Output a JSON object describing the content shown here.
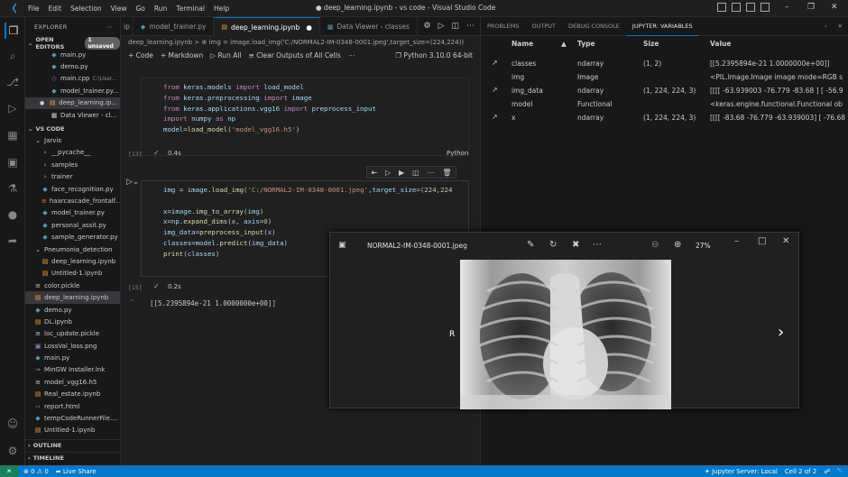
{
  "titlebar": {
    "menu": [
      "File",
      "Edit",
      "Selection",
      "View",
      "Go",
      "Run",
      "Terminal",
      "Help"
    ],
    "window_title": "● deep_learning.ipynb - vs code - Visual Studio Code"
  },
  "sidebar": {
    "header": "EXPLORER",
    "open_editors_label": "OPEN EDITORS",
    "unsaved_badge": "1 unsaved",
    "open_editors": [
      {
        "name": "main.py",
        "icon": "python-icon"
      },
      {
        "name": "demo.py",
        "icon": "python-icon"
      },
      {
        "name": "main.cpp",
        "path": "C:\\User...",
        "icon": "cpp-icon"
      },
      {
        "name": "model_trainer.py...",
        "icon": "python-icon"
      },
      {
        "name": "deep_learning.ip...",
        "icon": "notebook-icon"
      },
      {
        "name": "Data Viewer - cl...",
        "icon": "data-icon"
      }
    ],
    "vscode_label": "VS CODE",
    "files": [
      {
        "name": "Jarvis",
        "type": "folder-open"
      },
      {
        "name": "__pycache__",
        "type": "folder"
      },
      {
        "name": "samples",
        "type": "folder"
      },
      {
        "name": "trainer",
        "type": "folder"
      },
      {
        "name": "face_recognition.py",
        "type": "python"
      },
      {
        "name": "haarcascade_frontalf...",
        "type": "xml"
      },
      {
        "name": "model_trainer.py",
        "type": "python"
      },
      {
        "name": "personal_assit.py",
        "type": "python"
      },
      {
        "name": "sample_generator.py",
        "type": "python"
      },
      {
        "name": "Pneumonia_detection",
        "type": "folder-open"
      },
      {
        "name": "deep_learning.ipynb",
        "type": "notebook"
      },
      {
        "name": "Untitled-1.ipynb",
        "type": "notebook"
      },
      {
        "name": "color.pickle",
        "type": "pickle"
      },
      {
        "name": "deep_learning.ipynb",
        "type": "notebook"
      },
      {
        "name": "demo.py",
        "type": "python"
      },
      {
        "name": "DL.ipynb",
        "type": "notebook"
      },
      {
        "name": "loc_update.pickle",
        "type": "pickle"
      },
      {
        "name": "LossVal_loss.png",
        "type": "image"
      },
      {
        "name": "main.py",
        "type": "python"
      },
      {
        "name": "MinGW Installer.lnk",
        "type": "link"
      },
      {
        "name": "model_vgg16.h5",
        "type": "h5"
      },
      {
        "name": "Real_estate.ipynb",
        "type": "notebook"
      },
      {
        "name": "report.html",
        "type": "html"
      },
      {
        "name": "tempCodeRunnerFile....",
        "type": "python"
      },
      {
        "name": "Untitled-1.ipynb",
        "type": "notebook"
      }
    ],
    "outline_label": "OUTLINE",
    "timeline_label": "TIMELINE"
  },
  "tabs": [
    {
      "label": "model_trainer.py",
      "active": false
    },
    {
      "label": "deep_learning.ipynb",
      "active": true,
      "dirty": true
    },
    {
      "label": "Data Viewer - classes",
      "active": false
    }
  ],
  "tab_fragment": "ip",
  "breadcrumb": "deep_learning.ipynb > ⊕ img = image.load_img('C:/NORMAL2-IM-0348-0001.jpeg',target_size=(224,224))",
  "toolbar": {
    "code": "+ Code",
    "markdown": "+ Markdown",
    "run_all": "Run All",
    "clear": "Clear Outputs of All Cells",
    "kernel": "Python 3.10.0 64-bit"
  },
  "cell1": {
    "lines": [
      [
        {
          "t": "from ",
          "c": "kw"
        },
        {
          "t": "keras.models ",
          "c": "var"
        },
        {
          "t": "import ",
          "c": "kw"
        },
        {
          "t": "load_model",
          "c": "var"
        }
      ],
      [
        {
          "t": "from ",
          "c": "kw"
        },
        {
          "t": "keras.preprocessing ",
          "c": "var"
        },
        {
          "t": "import ",
          "c": "kw"
        },
        {
          "t": "image",
          "c": "var"
        }
      ],
      [
        {
          "t": "from ",
          "c": "kw"
        },
        {
          "t": "keras.applications.vgg16 ",
          "c": "var"
        },
        {
          "t": "import ",
          "c": "kw"
        },
        {
          "t": "preprocess_input",
          "c": "var"
        }
      ],
      [
        {
          "t": "import ",
          "c": "kw"
        },
        {
          "t": "numpy ",
          "c": "var"
        },
        {
          "t": "as ",
          "c": "kw"
        },
        {
          "t": "np",
          "c": "var"
        }
      ],
      [
        {
          "t": "model",
          "c": "var"
        },
        {
          "t": "=",
          "c": ""
        },
        {
          "t": "load_model",
          "c": "fn"
        },
        {
          "t": "(",
          "c": ""
        },
        {
          "t": "'model_vgg16.h5'",
          "c": "str"
        },
        {
          "t": ")",
          "c": ""
        }
      ]
    ],
    "exec_count": "[13]",
    "time": "0.4s",
    "language": "Python"
  },
  "cell2": {
    "lines": [
      [
        {
          "t": "img ",
          "c": "var"
        },
        {
          "t": "= ",
          "c": ""
        },
        {
          "t": "image",
          "c": "var"
        },
        {
          "t": ".",
          "c": ""
        },
        {
          "t": "load_img",
          "c": "fn"
        },
        {
          "t": "(",
          "c": ""
        },
        {
          "t": "'C:/NORMAL2-IM-0348-0001.jpeg'",
          "c": "str"
        },
        {
          "t": ",",
          "c": ""
        },
        {
          "t": "target_size",
          "c": "var"
        },
        {
          "t": "=(",
          "c": ""
        },
        {
          "t": "224",
          "c": "num"
        },
        {
          "t": ",",
          "c": ""
        },
        {
          "t": "224",
          "c": "num"
        }
      ],
      [],
      [
        {
          "t": "x",
          "c": "var"
        },
        {
          "t": "=",
          "c": ""
        },
        {
          "t": "image",
          "c": "var"
        },
        {
          "t": ".",
          "c": ""
        },
        {
          "t": "img_to_array",
          "c": "fn"
        },
        {
          "t": "(",
          "c": ""
        },
        {
          "t": "img",
          "c": "var"
        },
        {
          "t": ")",
          "c": ""
        }
      ],
      [
        {
          "t": "x",
          "c": "var"
        },
        {
          "t": "=",
          "c": ""
        },
        {
          "t": "np",
          "c": "var"
        },
        {
          "t": ".",
          "c": ""
        },
        {
          "t": "expand_dims",
          "c": "fn"
        },
        {
          "t": "(",
          "c": ""
        },
        {
          "t": "x",
          "c": "var"
        },
        {
          "t": ", ",
          "c": ""
        },
        {
          "t": "axis",
          "c": "var"
        },
        {
          "t": "=",
          "c": ""
        },
        {
          "t": "0",
          "c": "num"
        },
        {
          "t": ")",
          "c": ""
        }
      ],
      [
        {
          "t": "img_data",
          "c": "var"
        },
        {
          "t": "=",
          "c": ""
        },
        {
          "t": "preprocess_input",
          "c": "fn"
        },
        {
          "t": "(",
          "c": ""
        },
        {
          "t": "x",
          "c": "var"
        },
        {
          "t": ")",
          "c": ""
        }
      ],
      [
        {
          "t": "classes",
          "c": "var"
        },
        {
          "t": "=",
          "c": ""
        },
        {
          "t": "model",
          "c": "var"
        },
        {
          "t": ".",
          "c": ""
        },
        {
          "t": "predict",
          "c": "fn"
        },
        {
          "t": "(",
          "c": ""
        },
        {
          "t": "img_data",
          "c": "var"
        },
        {
          "t": ")",
          "c": ""
        }
      ],
      [
        {
          "t": "print",
          "c": "fn"
        },
        {
          "t": "(",
          "c": ""
        },
        {
          "t": "classes",
          "c": "var"
        },
        {
          "t": ")",
          "c": ""
        }
      ]
    ],
    "exec_count": "[15]",
    "time": "0.2s",
    "output": "[[5.2395894e-21 1.0000000e+00]]"
  },
  "panel": {
    "tabs": [
      "PROBLEMS",
      "OUTPUT",
      "DEBUG CONSOLE",
      "JUPYTER: VARIABLES"
    ],
    "headers": {
      "name": "Name",
      "type": "Type",
      "size": "Size",
      "value": "Value"
    },
    "rows": [
      {
        "name": "classes",
        "type": "ndarray",
        "size": "(1, 2)",
        "value": "[[5.2395894e-21 1.0000000e+00]]",
        "expand": true
      },
      {
        "name": "img",
        "type": "Image",
        "size": "",
        "value": "<PIL.Image.Image image mode=RGB s",
        "expand": false
      },
      {
        "name": "img_data",
        "type": "ndarray",
        "size": "(1, 224, 224, 3)",
        "value": "[[[[ -63.939003 -76.779 -83.68 ] [ -56.9",
        "expand": true
      },
      {
        "name": "model",
        "type": "Functional",
        "size": "",
        "value": "<keras.engine.functional.Functional ob",
        "expand": false
      },
      {
        "name": "x",
        "type": "ndarray",
        "size": "(1, 224, 224, 3)",
        "value": "[[[[ -83.68 -76.779 -63.939003] [ -76.68",
        "expand": true
      }
    ]
  },
  "viewer": {
    "filename": "NORMAL2-IM-0348-0001.jpeg",
    "zoom": "27%",
    "marker": "R"
  },
  "statusbar": {
    "errors": "0",
    "warnings": "0",
    "live_share": "Live Share",
    "jupyter_server": "Jupyter Server: Local",
    "cell_position": "Cell 2 of 2"
  }
}
